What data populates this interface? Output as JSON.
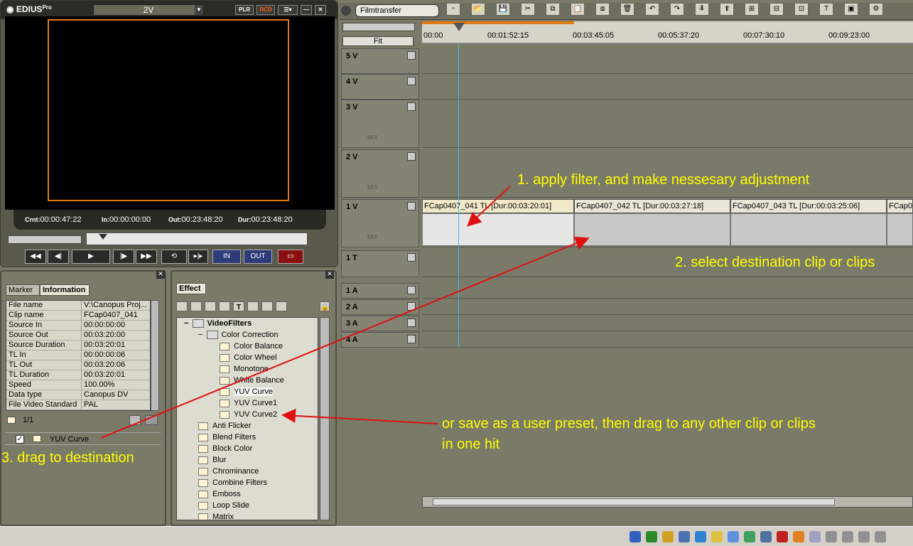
{
  "player": {
    "brand": "EDIUS",
    "brand_suffix": "Pro",
    "track_select": "2V",
    "plr": "PLR",
    "rcd": "RCD",
    "timecodes": [
      {
        "label": "Crnt:",
        "value": "00:00:47:22"
      },
      {
        "label": "In:",
        "value": "00:00:00:00"
      },
      {
        "label": "Out:",
        "value": "00:23:48:20"
      },
      {
        "label": "Dur:",
        "value": "00:23:48:20"
      }
    ],
    "transport": [
      "◀◀",
      "◀|",
      "▶",
      "|▶",
      "▶▶",
      "⟲",
      "▸|▸",
      "IN",
      "OUT",
      "▭"
    ]
  },
  "info_panel": {
    "tabs": [
      "Marker",
      "Information"
    ],
    "rows": [
      [
        "File name",
        "V:\\Canopus Proj..."
      ],
      [
        "Clip name",
        "FCap0407_041"
      ],
      [
        "Source In",
        "00:00:00:00"
      ],
      [
        "Source Out",
        "00:03:20:00"
      ],
      [
        "Source Duration",
        "00:03:20:01"
      ],
      [
        "TL In",
        "00:00:00:06"
      ],
      [
        "TL Out",
        "00:03:20:06"
      ],
      [
        "TL Duration",
        "00:03:20:01"
      ],
      [
        "Speed",
        "100.00%"
      ],
      [
        "Data type",
        "Canopus DV"
      ],
      [
        "File Video Standard",
        "PAL"
      ]
    ],
    "page": "1/1",
    "applied_filter": "YUV Curve"
  },
  "effect_panel": {
    "tab": "Effect",
    "tree": [
      {
        "label": "VideoFilters",
        "level": 0,
        "bold": true
      },
      {
        "label": "Color Correction",
        "level": 1
      },
      {
        "label": "Color Balance",
        "level": 2
      },
      {
        "label": "Color Wheel",
        "level": 2
      },
      {
        "label": "Monotone",
        "level": 2
      },
      {
        "label": "White Balance",
        "level": 2
      },
      {
        "label": "YUV Curve",
        "level": 2,
        "selected": true
      },
      {
        "label": "YUV Curve1",
        "level": 2
      },
      {
        "label": "YUV Curve2",
        "level": 2
      },
      {
        "label": "Anti Flicker",
        "level": 1
      },
      {
        "label": "Blend Filters",
        "level": 1
      },
      {
        "label": "Block Color",
        "level": 1
      },
      {
        "label": "Blur",
        "level": 1
      },
      {
        "label": "Chrominance",
        "level": 1
      },
      {
        "label": "Combine Filters",
        "level": 1
      },
      {
        "label": "Emboss",
        "level": 1
      },
      {
        "label": "Loop Slide",
        "level": 1
      },
      {
        "label": "Matrix",
        "level": 1
      }
    ]
  },
  "timeline": {
    "sequence_name": "Filmtransfer",
    "zoom": "Fit",
    "ruler": [
      "00:00",
      "00:01:52:15",
      "00:03:45:05",
      "00:05:37:20",
      "00:07:30:10",
      "00:09:23:00"
    ],
    "tracks": [
      {
        "label": "5 V"
      },
      {
        "label": "4 V"
      },
      {
        "label": "3 V"
      },
      {
        "label": "2 V"
      },
      {
        "label": "1 V"
      },
      {
        "label": "1 T"
      },
      {
        "label": "1 A"
      },
      {
        "label": "2 A"
      },
      {
        "label": "3 A"
      },
      {
        "label": "4 A"
      }
    ],
    "mix": "MIX",
    "clips": [
      "FCap0407_041 TL [Dur:00:03:20:01]",
      "FCap0407_042 TL [Dur:00:03:27:18]",
      "FCap0407_043 TL [Dur:00:03:25:06]",
      "FCap0"
    ]
  },
  "annotations": {
    "a1": "1. apply filter, and make nessesary adjustment",
    "a2": "2. select destination clip or clips",
    "a3": "3. drag to destination",
    "a4_line1": "or save as a user preset, then drag to any other clip or clips",
    "a4_line2": "in one hit"
  },
  "colors": {
    "annotation": "#ffff00",
    "arrow": "#e01010",
    "safe_area": "#e07a14"
  }
}
